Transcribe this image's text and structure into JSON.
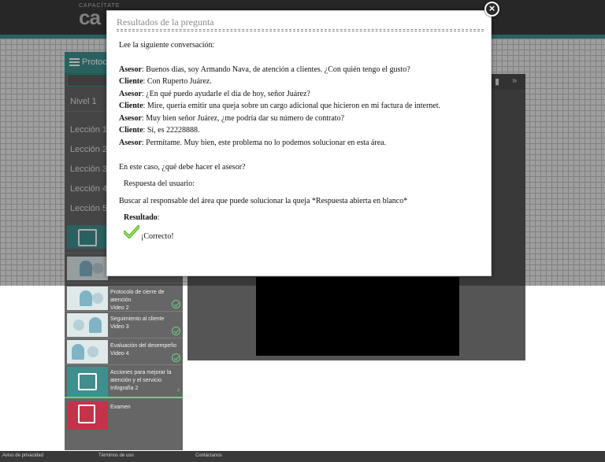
{
  "app": {
    "logo_small": "CAPACÍTATE",
    "logo_big": "ca"
  },
  "sidebar": {
    "header": "Protocolo",
    "nivel": "Nivel 1",
    "lessons": [
      "Lección 1",
      "Lección 2",
      "Lección 3",
      "Lección 4",
      "Lección 5"
    ],
    "items": [
      {
        "title": "Protocolo de cierre de atención",
        "subtitle": "Video 2",
        "status": "completed"
      },
      {
        "title": "Seguimiento al cliente",
        "subtitle": "Video 3",
        "status": "completed"
      },
      {
        "title": "Evaluación del desempeño",
        "subtitle": "Video 4",
        "status": "completed"
      },
      {
        "title": "Acciones para mejorar la atención y el servicio",
        "subtitle": "Infografía 2",
        "status": "next"
      },
      {
        "title": "Examen",
        "subtitle": "",
        "status": "none"
      }
    ]
  },
  "footer": {
    "links": [
      "Aviso de privacidad",
      "Términos de uso",
      "Contáctanos"
    ]
  },
  "modal": {
    "title": "Resultados de la pregunta",
    "intro": "Lee la siguiente conversación:",
    "conversation": [
      {
        "speaker": "Asesor",
        "text": ": Buenos días, soy Armando Nava, de atención a clientes. ¿Con quién tengo el gusto?"
      },
      {
        "speaker": "Cliente",
        "text": ": Con Ruperto Juárez."
      },
      {
        "speaker": "Asesor",
        "text": ": ¿En qué puedo ayudarle el día de hoy, señor Juárez?"
      },
      {
        "speaker": "Cliente",
        "text": ": Mire, quería emitir una queja sobre un cargo adicional que hicieron en mi factura de internet."
      },
      {
        "speaker": "Asesor",
        "text": ": Muy bien señor Juárez, ¿me podría dar su número de contrato?"
      },
      {
        "speaker": "Cliente",
        "text": ": Sí, es 22228888."
      },
      {
        "speaker": "Asesor",
        "text": ": Permítame. Muy bien, este problema no lo podemos solucionar en esta área."
      }
    ],
    "question": "En este caso, ¿qué debe hacer el asesor?",
    "user_answer_label": "Respuesta del usuario:",
    "user_answer": "Buscar al responsable del área que puede solucionar la queja *Respuesta abierta en blanco*",
    "result_label": "Resultado",
    "result_value": "¡Correcto!",
    "close_icon": "close-icon"
  }
}
